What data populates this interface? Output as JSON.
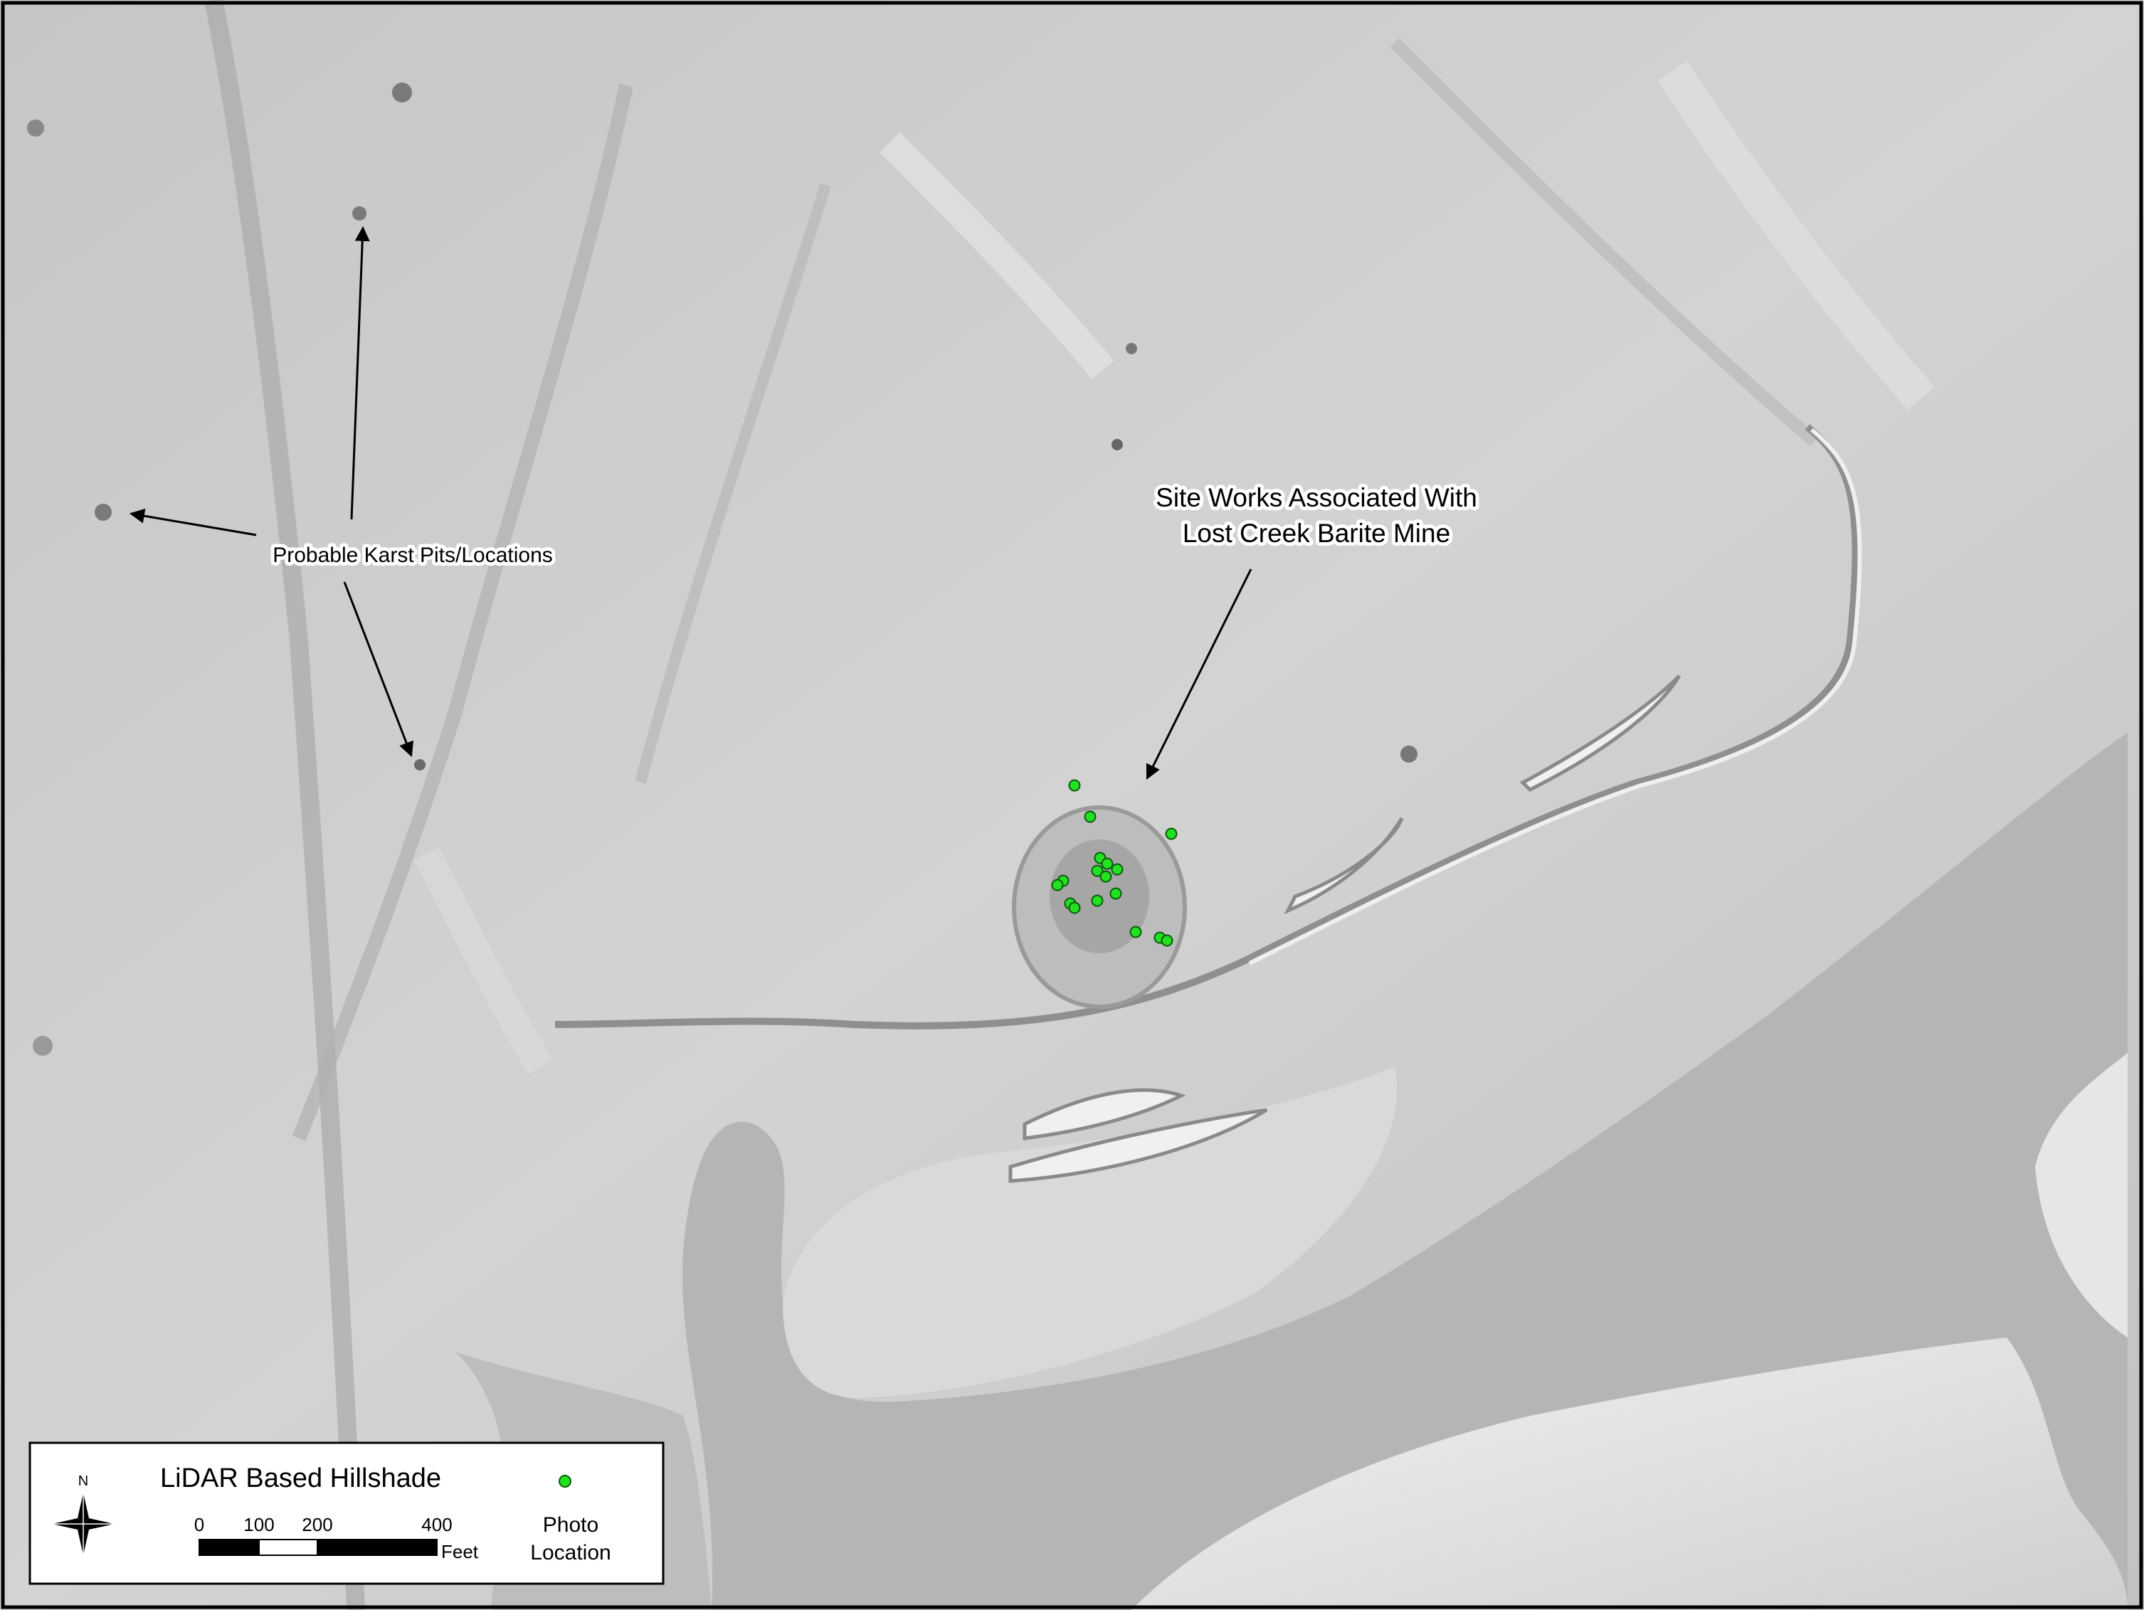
{
  "annotations": {
    "karst_label": "Probable Karst Pits/Locations",
    "site_label_line1": "Site Works Associated With",
    "site_label_line2": "Lost Creek Barite Mine"
  },
  "legend": {
    "title": "LiDAR Based Hillshade",
    "north_label": "N",
    "scale_ticks": [
      "0",
      "100",
      "200",
      "400"
    ],
    "scale_unit": "Feet",
    "photo_label_line1": "Photo",
    "photo_label_line2": "Location"
  },
  "colors": {
    "terrain": "#cfcfcf",
    "lowland": "#b3b3b3",
    "highlight": "#ececec",
    "photo_point": "#22e022",
    "frame": "#000000"
  }
}
